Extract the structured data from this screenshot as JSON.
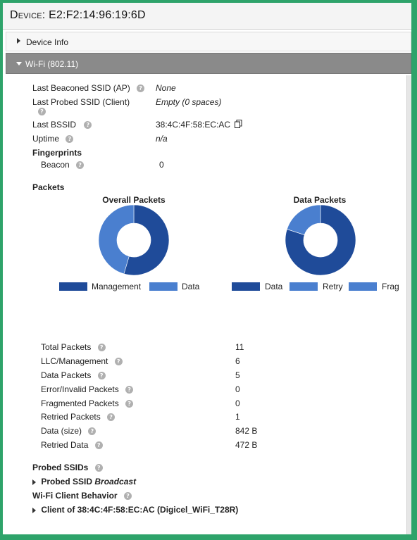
{
  "header": {
    "title_prefix": "Device:",
    "device_id": "E2:F2:14:96:19:6D"
  },
  "sections": {
    "device_info_label": "Device Info",
    "wifi_label": "Wi-Fi (802.11)"
  },
  "wifi": {
    "fields": {
      "last_beaconed_ssid": {
        "label": "Last Beaconed SSID (AP)",
        "value": "None"
      },
      "last_probed_ssid": {
        "label": "Last Probed SSID (Client)",
        "value": "Empty (0 spaces)"
      },
      "last_bssid": {
        "label": "Last BSSID",
        "value": "38:4C:4F:58:EC:AC"
      },
      "uptime": {
        "label": "Uptime",
        "value": "n/a"
      }
    },
    "fingerprints_heading": "Fingerprints",
    "beacon": {
      "label": "Beacon",
      "value": "0"
    },
    "packets_heading": "Packets"
  },
  "chart_data": [
    {
      "type": "pie",
      "title": "Overall Packets",
      "categories": [
        "Management",
        "Data"
      ],
      "values": [
        6,
        5
      ],
      "colors": [
        "#1f4b99",
        "#4a7fcf"
      ],
      "legend": "bottom"
    },
    {
      "type": "pie",
      "title": "Data Packets",
      "categories": [
        "Data",
        "Retry",
        "Frag"
      ],
      "values": [
        4,
        1,
        0
      ],
      "colors": [
        "#1f4b99",
        "#4a7fcf",
        "#4a7fcf"
      ],
      "legend": "bottom"
    }
  ],
  "stats": [
    {
      "label": "Total Packets",
      "value": "11"
    },
    {
      "label": "LLC/Management",
      "value": "6"
    },
    {
      "label": "Data Packets",
      "value": "5"
    },
    {
      "label": "Error/Invalid Packets",
      "value": "0"
    },
    {
      "label": "Fragmented Packets",
      "value": "0"
    },
    {
      "label": "Retried Packets",
      "value": "1"
    },
    {
      "label": "Data (size)",
      "value": "842 B"
    },
    {
      "label": "Retried Data",
      "value": "472 B"
    }
  ],
  "probed": {
    "heading": "Probed SSIDs",
    "item_prefix": "Probed SSID",
    "item_name": "Broadcast"
  },
  "client_behavior": {
    "heading": "Wi-Fi Client Behavior",
    "item": "Client of 38:4C:4F:58:EC:AC (Digicel_WiFi_T28R)"
  },
  "icons": {
    "help": "question-circle-icon",
    "copy": "copy-icon",
    "expand": "triangle-right-icon",
    "collapse": "triangle-down-icon"
  }
}
